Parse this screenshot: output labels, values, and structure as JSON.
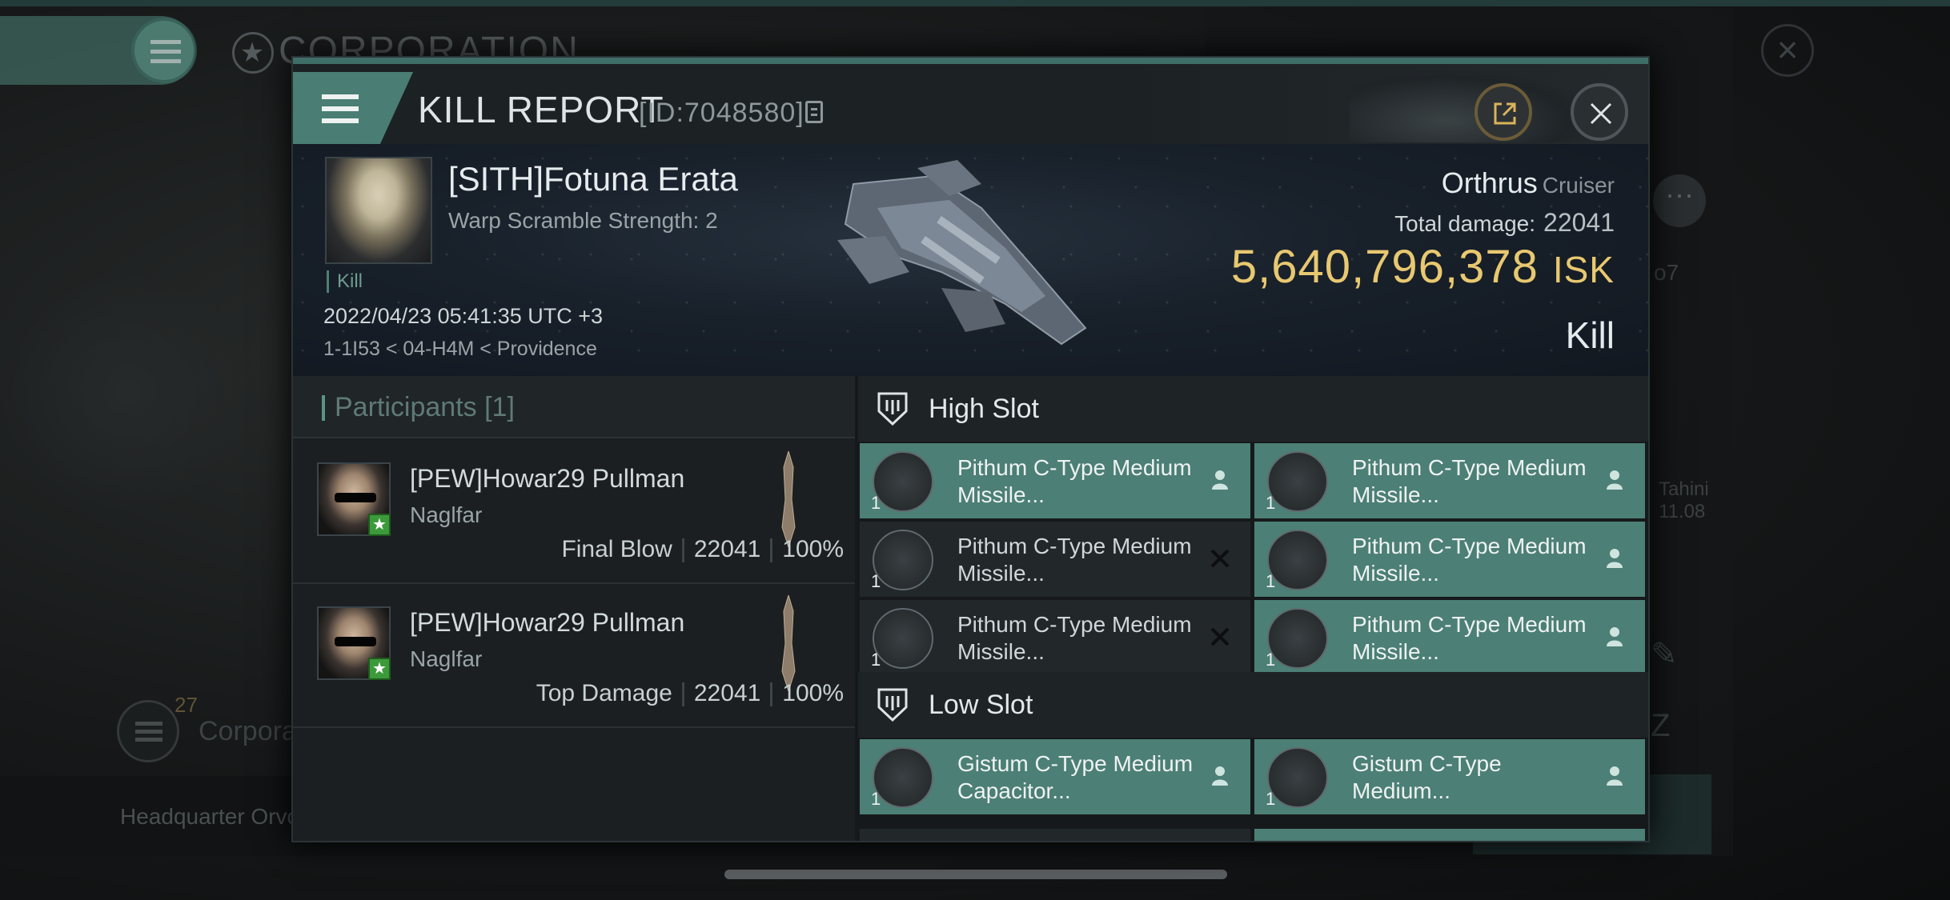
{
  "background": {
    "title": "CORPORATION",
    "ghost_right_1": "o7",
    "ghost_right_2": "Tahini",
    "ghost_right_3": "11.08",
    "member_count": "27",
    "corp_label": "Corpora",
    "hq_label": "Headquarter Orvc"
  },
  "modal": {
    "title": "KILL REPORT",
    "id_label": "[ID:7048580]"
  },
  "victim": {
    "name": "[SITH]Fotuna Erata",
    "subtitle": "Warp Scramble Strength: 2",
    "tag": "Kill",
    "datetime": "2022/04/23 05:41:35 UTC +3",
    "location": "1-1I53 < 04-H4M < Providence",
    "ship": "Orthrus",
    "ship_class": "Cruiser",
    "total_damage_label": "Total damage:",
    "total_damage": "22041",
    "isk_value": "5,640,796,378",
    "isk_unit": "ISK",
    "report_type": "Kill"
  },
  "participants": {
    "header": "Participants [1]",
    "rows": [
      {
        "name": "[PEW]Howar29 Pullman",
        "ship": "Naglfar",
        "role": "Final Blow",
        "damage": "22041",
        "percent": "100%"
      },
      {
        "name": "[PEW]Howar29 Pullman",
        "ship": "Naglfar",
        "role": "Top Damage",
        "damage": "22041",
        "percent": "100%"
      }
    ]
  },
  "fitting": {
    "high_slot_label": "High Slot",
    "low_slot_label": "Low Slot",
    "high": [
      {
        "qty": "1",
        "name": "Pithum C-Type Medium Missile...",
        "state": "dropped"
      },
      {
        "qty": "1",
        "name": "Pithum C-Type Medium Missile...",
        "state": "dropped"
      },
      {
        "qty": "1",
        "name": "Pithum C-Type Medium Missile...",
        "state": "destroyed"
      },
      {
        "qty": "1",
        "name": "Pithum C-Type Medium Missile...",
        "state": "dropped"
      },
      {
        "qty": "1",
        "name": "Pithum C-Type Medium Missile...",
        "state": "destroyed"
      },
      {
        "qty": "1",
        "name": "Pithum C-Type Medium Missile...",
        "state": "dropped"
      }
    ],
    "low": [
      {
        "qty": "1",
        "name": "Gistum C-Type Medium Capacitor...",
        "state": "dropped"
      },
      {
        "qty": "1",
        "name": "Gistum C-Type Medium...",
        "state": "dropped"
      }
    ]
  },
  "colors": {
    "accent_teal": "#4c7f76",
    "isk_gold": "#e8c870",
    "dropped_bg": "#4c7f76",
    "destroyed_bg": "#22272a"
  },
  "icons": [
    "menu-icon",
    "copy-icon",
    "share-icon",
    "close-icon",
    "shield-icon",
    "person-icon",
    "x-icon",
    "star-icon"
  ]
}
